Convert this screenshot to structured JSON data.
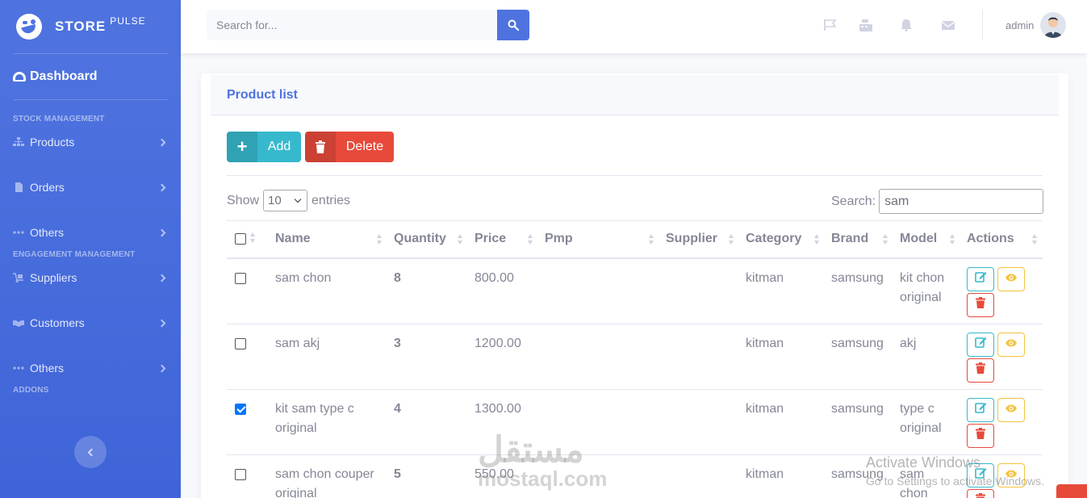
{
  "brand": {
    "name": "STORE",
    "sup": "PULSE"
  },
  "sidebar": {
    "dashboard": "Dashboard",
    "section_stock": "STOCK MANAGEMENT",
    "section_engagement": "ENGAGEMENT MANAGEMENT",
    "section_addons": "ADDONS",
    "items": [
      {
        "label": "Products",
        "icon": "sitemap-icon"
      },
      {
        "label": "Orders",
        "icon": "file-icon"
      },
      {
        "label": "Others",
        "icon": "ellipsis-icon"
      },
      {
        "label": "Suppliers",
        "icon": "dolly-icon"
      },
      {
        "label": "Customers",
        "icon": "handshake-icon"
      },
      {
        "label": "Others",
        "icon": "ellipsis-icon"
      }
    ]
  },
  "topbar": {
    "search_placeholder": "Search for...",
    "user": "admin"
  },
  "card": {
    "title": "Product list",
    "add_label": "Add",
    "delete_label": "Delete",
    "show_label": "Show",
    "entries_label": "entries",
    "length_value": "10",
    "search_label": "Search:",
    "search_value": "sam"
  },
  "table": {
    "headers": [
      "Name",
      "Quantity",
      "Price",
      "Pmp",
      "Supplier",
      "Category",
      "Brand",
      "Model",
      "Actions"
    ],
    "rows": [
      {
        "checked": false,
        "name": "sam chon",
        "qty": "8",
        "price": "800.00",
        "pmp": "",
        "supplier": "",
        "category": "kitman",
        "brand": "samsung",
        "model": "kit chon original"
      },
      {
        "checked": false,
        "name": "sam akj",
        "qty": "3",
        "price": "1200.00",
        "pmp": "",
        "supplier": "",
        "category": "kitman",
        "brand": "samsung",
        "model": "akj"
      },
      {
        "checked": true,
        "name": "kit sam type c original",
        "qty": "4",
        "price": "1300.00",
        "pmp": "",
        "supplier": "",
        "category": "kitman",
        "brand": "samsung",
        "model": "type c original"
      },
      {
        "checked": false,
        "name": "sam chon couper original",
        "qty": "5",
        "price": "550.00",
        "pmp": "",
        "supplier": "",
        "category": "kitman",
        "brand": "samsung",
        "model": "sam chon"
      }
    ]
  },
  "overlay": {
    "activate_title": "Activate Windows",
    "activate_sub": "Go to Settings to activate Windows.",
    "wm_logo": "مستقل",
    "wm_sub": "mostaql.com"
  },
  "colors": {
    "primary": "#4e73df",
    "info": "#36b9cc",
    "danger": "#e74a3b",
    "warning": "#f6c23e"
  }
}
